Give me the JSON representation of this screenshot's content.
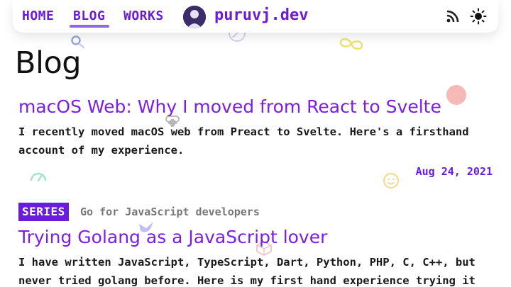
{
  "nav": {
    "links": [
      {
        "label": "HOME"
      },
      {
        "label": "BLOG"
      },
      {
        "label": "WORKS"
      }
    ],
    "brand": "puruvj.dev",
    "rss_icon": "rss-icon",
    "theme_icon": "sun-icon"
  },
  "page": {
    "title": "Blog"
  },
  "posts": [
    {
      "title": "macOS Web: Why I moved from React to Svelte",
      "description": "I recently moved macOS web from Preact to Svelte. Here's a firsthand account of my experience.",
      "date": "Aug 24, 2021"
    },
    {
      "series_label": "SERIES",
      "series_name": "Go for JavaScript developers",
      "title": "Trying Golang as a JavaScript lover",
      "description": "I have written JavaScript, TypeScript, Dart, Python, PHP, C, C++, but never tried golang before. Here is my first hand experience trying it"
    }
  ],
  "colors": {
    "accent": "#6a1bdc",
    "title": "#7b1ee6"
  }
}
